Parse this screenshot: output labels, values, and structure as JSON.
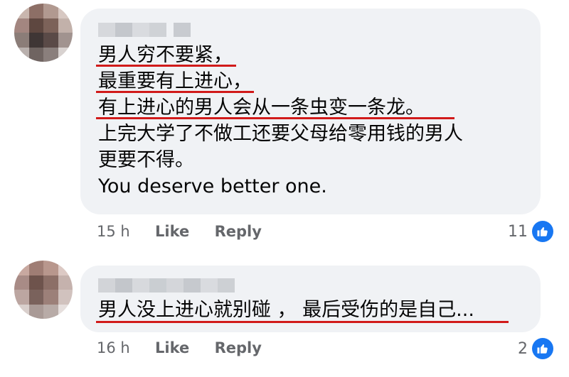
{
  "comments": [
    {
      "lines": [
        "男人穷不要紧，",
        "最重要有上进心，",
        "有上进心的男人会从一条虫变一条龙。",
        "上完大学了不做工还要父母给零用钱的男人",
        "更要不得。",
        "You deserve better one."
      ],
      "time": "15 h",
      "like_label": "Like",
      "reply_label": "Reply",
      "reaction_count": "11"
    },
    {
      "lines": [
        "男人没上进心就别碰 ， 最后受伤的是自己..."
      ],
      "time": "16 h",
      "like_label": "Like",
      "reply_label": "Reply",
      "reaction_count": "2"
    }
  ],
  "colors": {
    "bubble": "#f0f2f5",
    "meta_text": "#65676b",
    "like_blue": "#1877f2",
    "underline_red": "#d11a1a"
  },
  "icons": {
    "reaction": "thumbs-up-icon",
    "avatar": "blurred-avatar"
  }
}
